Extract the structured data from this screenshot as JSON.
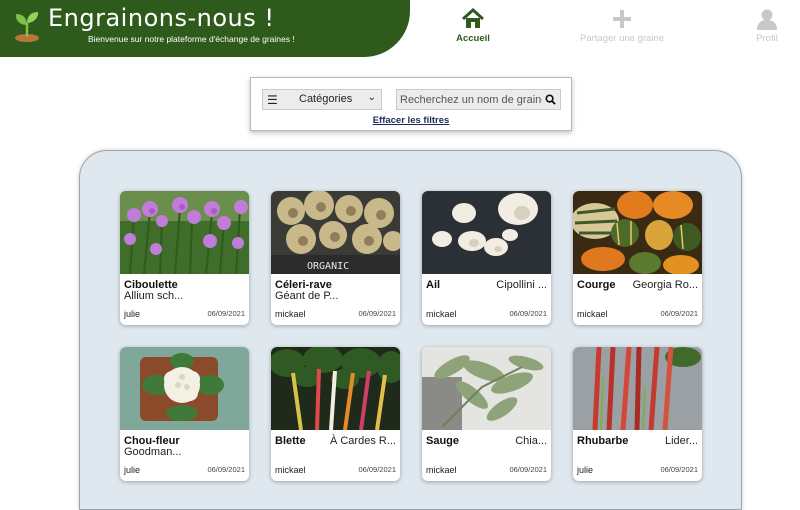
{
  "header": {
    "title": "Engrainons-nous !",
    "subtitle": "Bienvenue sur notre plateforme d'échange de graines !",
    "logo_icon": "sprout-icon",
    "brand_color": "#2e5a1c"
  },
  "nav": {
    "home": {
      "label": "Accueil",
      "icon": "home-icon",
      "active": true
    },
    "share": {
      "label": "Partager une graine",
      "icon": "plus-icon"
    },
    "profile": {
      "label": "Profil",
      "icon": "user-icon"
    }
  },
  "filters": {
    "category_label": "Catégories",
    "search_placeholder": "Recherchez un nom de graine",
    "clear_label": "Effacer les filtres"
  },
  "cards": [
    {
      "name": "Ciboulette",
      "variety": "Allium sch...",
      "user": "julie",
      "date": "06/09/2021",
      "image": "chives"
    },
    {
      "name": "Céleri-rave",
      "variety": "Géant de P...",
      "user": "mickael",
      "date": "06/09/2021",
      "image": "celeriac",
      "image_text": "ORGANIC"
    },
    {
      "name": "Ail",
      "variety": "Cipollini ...",
      "user": "mickael",
      "date": "06/09/2021",
      "image": "garlic"
    },
    {
      "name": "Courge",
      "variety": "Georgia Ro...",
      "user": "mickael",
      "date": "06/09/2021",
      "image": "squash"
    },
    {
      "name": "Chou-fleur",
      "variety": "Goodman...",
      "user": "julie",
      "date": "06/09/2021",
      "image": "cauliflower"
    },
    {
      "name": "Blette",
      "variety": "À Cardes R...",
      "user": "mickael",
      "date": "06/09/2021",
      "image": "chard"
    },
    {
      "name": "Sauge",
      "variety": "Chia...",
      "user": "mickael",
      "date": "06/09/2021",
      "image": "sage"
    },
    {
      "name": "Rhubarbe",
      "variety": "Lider...",
      "user": "julie",
      "date": "06/09/2021",
      "image": "rhubarb"
    }
  ]
}
